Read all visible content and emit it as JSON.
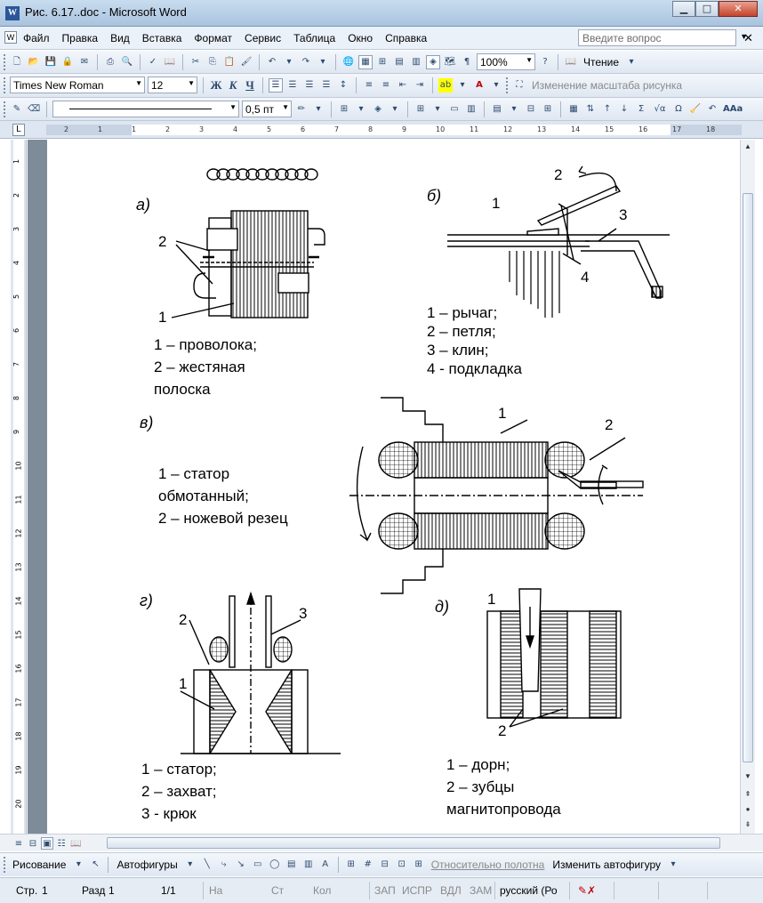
{
  "window": {
    "title": "Рис. 6.17..doc - Microsoft Word",
    "app_icon": "W"
  },
  "menu": {
    "items": [
      "Файл",
      "Правка",
      "Вид",
      "Вставка",
      "Формат",
      "Сервис",
      "Таблица",
      "Окно",
      "Справка"
    ],
    "ask_placeholder": "Введите вопрос"
  },
  "standard_toolbar": {
    "zoom": "100%",
    "reading": "Чтение"
  },
  "formatting_toolbar": {
    "font": "Times New Roman",
    "size": "12",
    "bold": "Ж",
    "italic": "К",
    "underline": "Ч",
    "picture_scale": "Изменение масштаба рисунка"
  },
  "drawing_line_toolbar": {
    "line_width": "0,5 пт",
    "sigma": "Σ",
    "sqrt_alpha": "√α",
    "omega": "Ω",
    "aa": "ААа"
  },
  "ruler": {
    "ticks": [
      "2",
      "1",
      "1",
      "2",
      "3",
      "4",
      "5",
      "6",
      "7",
      "8",
      "9",
      "10",
      "11",
      "12",
      "13",
      "14",
      "15",
      "16",
      "17",
      "18"
    ],
    "vticks": [
      "1",
      "2",
      "3",
      "4",
      "5",
      "6",
      "7",
      "8",
      "9",
      "10",
      "11",
      "12",
      "13",
      "14",
      "15",
      "16",
      "17",
      "18",
      "19",
      "20"
    ]
  },
  "figure": {
    "a_label": "а)",
    "b_label": "б)",
    "v_label": "в)",
    "g_label": "г)",
    "d_label": "д)",
    "a_legend": [
      "1 – проволока;",
      "2 – жестяная",
      "полоска"
    ],
    "b_legend": [
      "1 – рычаг;",
      "2 – петля;",
      "3 – клин;",
      "4 - подкладка"
    ],
    "v_legend": [
      "1 – статор",
      "обмотанный;",
      "2 – ножевой резец"
    ],
    "g_legend": [
      "1 – статор;",
      "2 – захват;",
      "3 - крюк"
    ],
    "d_legend": [
      "1 – дорн;",
      "2 – зубцы",
      "магнитопровода"
    ],
    "callouts": [
      "1",
      "2",
      "3",
      "4"
    ]
  },
  "drawing_toolbar": {
    "drawing": "Рисование",
    "autoshapes": "Автофигуры",
    "relative_canvas": "Относительно полотна",
    "change_autoshape": "Изменить автофигуру"
  },
  "status": {
    "page": "Стр.",
    "page_num": "1",
    "section": "Разд",
    "section_num": "1",
    "pages": "1/1",
    "at": "На",
    "line": "Ст",
    "col": "Кол",
    "rec": "ЗАП",
    "trk": "ИСПР",
    "ext": "ВДЛ",
    "ovr": "ЗАМ",
    "lang": "русский (Ро"
  }
}
